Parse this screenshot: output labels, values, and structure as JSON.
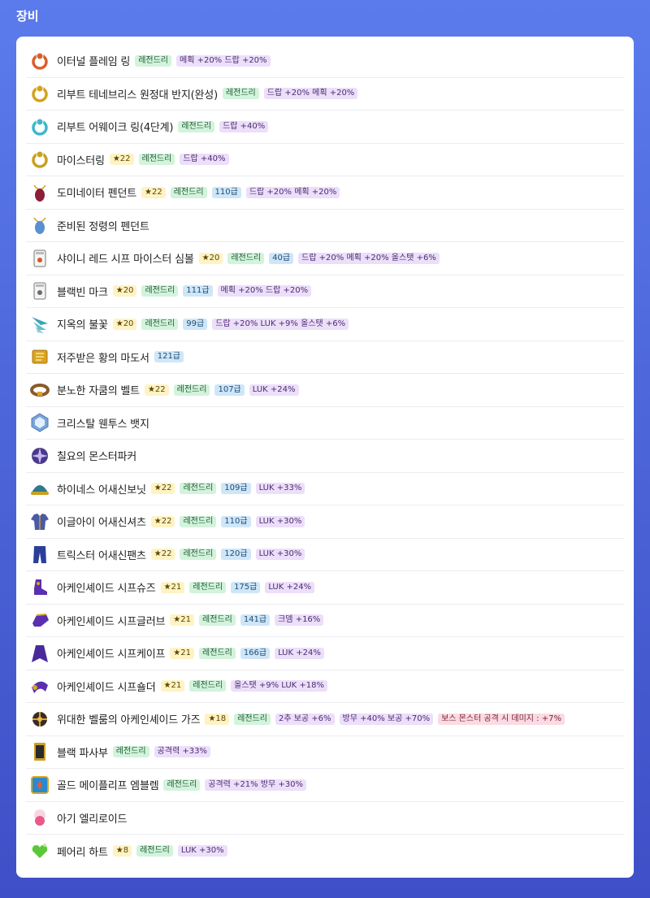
{
  "title": "장비",
  "items": [
    {
      "name": "이터널 플레임 링",
      "star": "",
      "tier": "레전드리",
      "level": "",
      "opts": [
        "메획 +20% 드랍 +20%"
      ],
      "icon": "ring-icon",
      "color": "#d9602a"
    },
    {
      "name": "리부트 테네브리스 원정대 반지(완성)",
      "star": "",
      "tier": "레전드리",
      "level": "",
      "opts": [
        "드랍 +20% 메획 +20%"
      ],
      "icon": "ring-icon",
      "color": "#d4a21c"
    },
    {
      "name": "리부트 어웨이크 링(4단계)",
      "star": "",
      "tier": "레전드리",
      "level": "",
      "opts": [
        "드랍 +40%"
      ],
      "icon": "ring-icon",
      "color": "#3fb7c9"
    },
    {
      "name": "마이스터링",
      "star": "★22",
      "tier": "레전드리",
      "level": "",
      "opts": [
        "드랍 +40%"
      ],
      "icon": "ring-icon",
      "color": "#c9a023"
    },
    {
      "name": "도미네이터 펜던트",
      "star": "★22",
      "tier": "레전드리",
      "level": "110급",
      "opts": [
        "드랍 +20% 메획 +20%"
      ],
      "icon": "pendant-icon",
      "color": "#8a1f3a"
    },
    {
      "name": "준비된 정령의 펜던트",
      "star": "",
      "tier": "",
      "level": "",
      "opts": [],
      "icon": "pendant-icon",
      "color": "#5a8fd0"
    },
    {
      "name": "샤이니 레드 시프 마이스터 심볼",
      "star": "★20",
      "tier": "레전드리",
      "level": "40급",
      "opts": [
        "드랍 +20% 메획 +20% 올스탯 +6%"
      ],
      "icon": "symbol-icon",
      "color": "#d05a2a"
    },
    {
      "name": "블랙빈 마크",
      "star": "★20",
      "tier": "레전드리",
      "level": "111급",
      "opts": [
        "메획 +20% 드랍 +20%"
      ],
      "icon": "badge-mark-icon",
      "color": "#6b6b6b"
    },
    {
      "name": "지옥의 불꽃",
      "star": "★20",
      "tier": "레전드리",
      "level": "99급",
      "opts": [
        "드랍 +20% LUK +9% 올스탯 +6%"
      ],
      "icon": "throwing-stars-icon",
      "color": "#3aa6b8"
    },
    {
      "name": "저주받은 황의 마도서",
      "star": "",
      "tier": "",
      "level": "121급",
      "opts": [],
      "icon": "spellbook-icon",
      "color": "#d9a520"
    },
    {
      "name": "분노한 자쿰의 벨트",
      "star": "★22",
      "tier": "레전드리",
      "level": "107급",
      "opts": [
        "LUK +24%"
      ],
      "icon": "belt-icon",
      "color": "#8a5a2a"
    },
    {
      "name": "크리스탈 웬투스 뱃지",
      "star": "",
      "tier": "",
      "level": "",
      "opts": [],
      "icon": "crystal-badge-icon",
      "color": "#7aa6d8"
    },
    {
      "name": "칠요의 몬스터파커",
      "star": "",
      "tier": "",
      "level": "",
      "opts": [],
      "icon": "medal-icon",
      "color": "#4a3a8a"
    },
    {
      "name": "하이네스 어새신보닛",
      "star": "★22",
      "tier": "레전드리",
      "level": "109급",
      "opts": [
        "LUK +33%"
      ],
      "icon": "hat-icon",
      "color": "#2f7a8a"
    },
    {
      "name": "이글아이 어새신셔츠",
      "star": "★22",
      "tier": "레전드리",
      "level": "110급",
      "opts": [
        "LUK +30%"
      ],
      "icon": "shirt-icon",
      "color": "#4a5aa8"
    },
    {
      "name": "트릭스터 어새신팬츠",
      "star": "★22",
      "tier": "레전드리",
      "level": "120급",
      "opts": [
        "LUK +30%"
      ],
      "icon": "pants-icon",
      "color": "#2a3f9a"
    },
    {
      "name": "아케인셰이드 시프슈즈",
      "star": "★21",
      "tier": "레전드리",
      "level": "175급",
      "opts": [
        "LUK +24%"
      ],
      "icon": "shoes-icon",
      "color": "#5a2fb0"
    },
    {
      "name": "아케인셰이드 시프글러브",
      "star": "★21",
      "tier": "레전드리",
      "level": "141급",
      "opts": [
        "크뎀 +16%"
      ],
      "icon": "glove-icon",
      "color": "#5a2fb0"
    },
    {
      "name": "아케인셰이드 시프케이프",
      "star": "★21",
      "tier": "레전드리",
      "level": "166급",
      "opts": [
        "LUK +24%"
      ],
      "icon": "cape-icon",
      "color": "#4a2a9a"
    },
    {
      "name": "아케인셰이드 시프숄더",
      "star": "★21",
      "tier": "레전드리",
      "level": "",
      "opts": [
        "올스탯 +9% LUK +18%"
      ],
      "icon": "shoulder-icon",
      "color": "#5a2fb0"
    },
    {
      "name": "위대한 벨룸의 아케인셰이드 가즈",
      "star": "★18",
      "tier": "레전드리",
      "level": "",
      "opts": [
        "2추 보공 +6%",
        "방무 +40% 보공 +70%"
      ],
      "boss": "보스 몬스터 공격 시 데미지 : +7%",
      "icon": "weapon-icon",
      "color": "#3a2a2a"
    },
    {
      "name": "블랙 파사부",
      "star": "",
      "tier": "레전드리",
      "level": "",
      "opts": [
        "공격력 +33%"
      ],
      "icon": "talisman-icon",
      "color": "#c9a023"
    },
    {
      "name": "골드 메이플리프 엠블렘",
      "star": "",
      "tier": "레전드리",
      "level": "",
      "opts": [
        "공격력 +21% 방무 +30%"
      ],
      "icon": "emblem-icon",
      "color": "#2a8ad0"
    },
    {
      "name": "아기 엘리로이드",
      "star": "",
      "tier": "",
      "level": "",
      "opts": [],
      "icon": "android-heart-icon",
      "color": "#e85a8a"
    },
    {
      "name": "페어리 하트",
      "star": "★8",
      "tier": "레전드리",
      "level": "",
      "opts": [
        "LUK +30%"
      ],
      "icon": "fairy-heart-icon",
      "color": "#5ac83a"
    }
  ]
}
